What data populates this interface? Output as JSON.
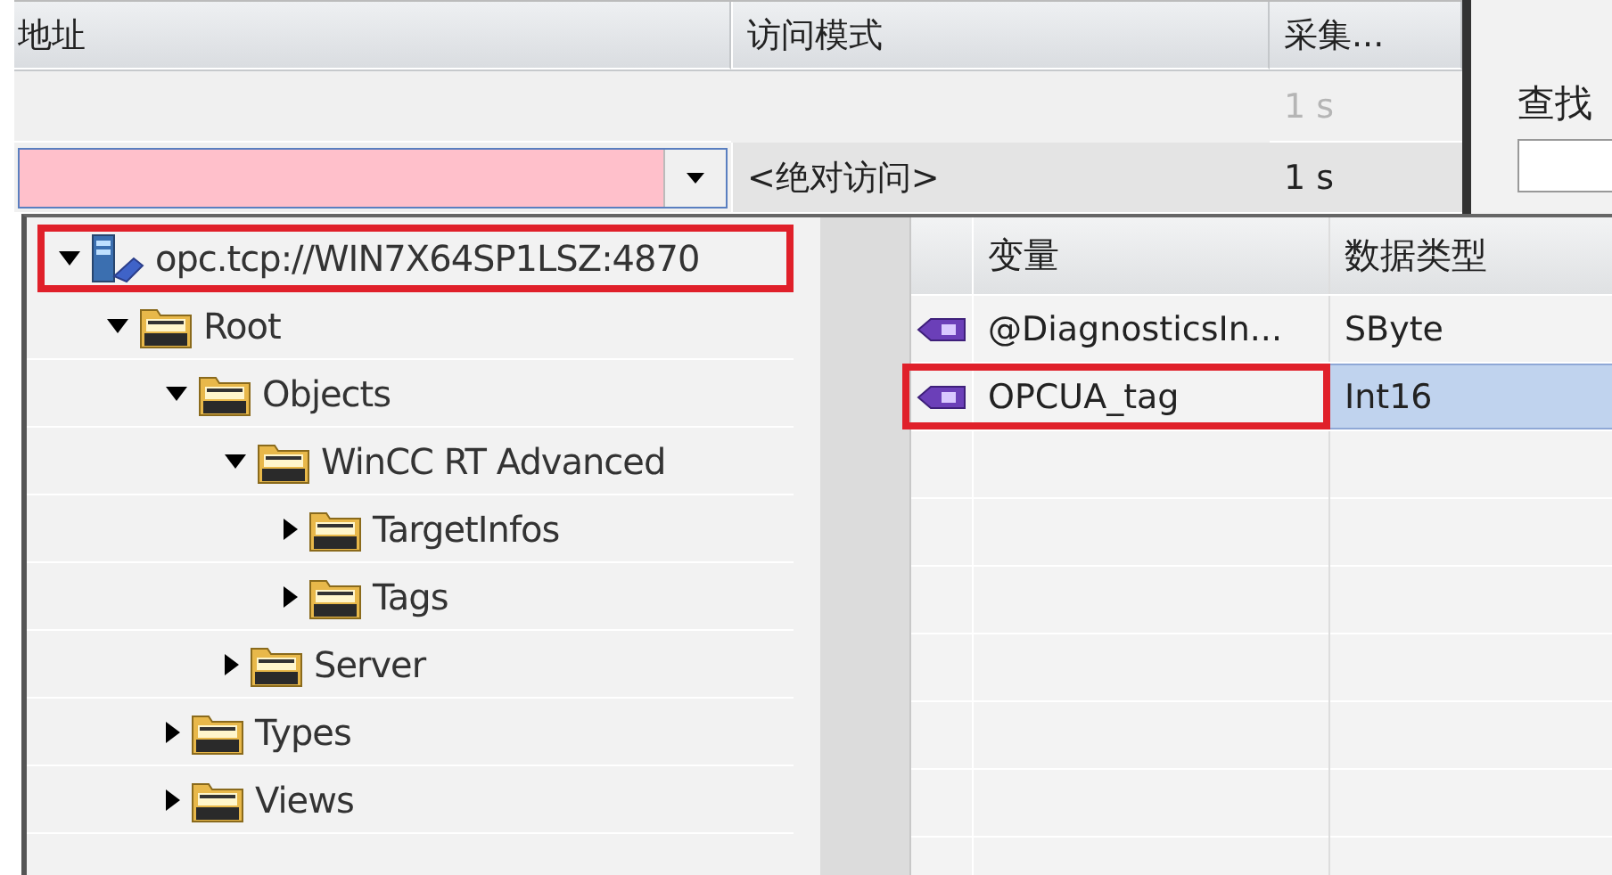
{
  "address_table": {
    "columns": [
      "地址",
      "访问模式",
      "采集..."
    ],
    "rows": [
      {
        "kind": "blank",
        "cycle": "1 s",
        "disabled": true
      },
      {
        "kind": "edit",
        "access_mode": "<绝对访问>",
        "cycle": "1 s",
        "invalid": true,
        "disabled": false
      }
    ]
  },
  "find_panel": {
    "label": "查找"
  },
  "browser": {
    "tree": [
      {
        "kind": "server",
        "label": "opc.tcp://WIN7X64SP1LSZ:4870",
        "expanded": true,
        "highlighted": true,
        "children": [
          {
            "kind": "folder",
            "label": "Root",
            "expanded": true,
            "highlighted": false,
            "children": [
              {
                "kind": "folder",
                "label": "Objects",
                "expanded": true,
                "highlighted": false,
                "children": [
                  {
                    "kind": "folder",
                    "label": "WinCC RT Advanced",
                    "expanded": true,
                    "highlighted": false,
                    "children": [
                      {
                        "kind": "folder",
                        "label": "TargetInfos",
                        "expanded": false,
                        "highlighted": false
                      },
                      {
                        "kind": "folder",
                        "label": "Tags",
                        "expanded": false,
                        "highlighted": false
                      }
                    ]
                  },
                  {
                    "kind": "folder",
                    "label": "Server",
                    "expanded": false,
                    "highlighted": false
                  }
                ]
              },
              {
                "kind": "folder",
                "label": "Types",
                "expanded": false,
                "highlighted": false
              },
              {
                "kind": "folder",
                "label": "Views",
                "expanded": false,
                "highlighted": false
              }
            ]
          }
        ]
      }
    ],
    "table": {
      "columns": [
        "变量",
        "数据类型"
      ],
      "rows": [
        {
          "name": "@DiagnosticsIn...",
          "type": "SByte",
          "selected": false,
          "highlighted": false
        },
        {
          "name": "OPCUA_tag",
          "type": "Int16",
          "selected": true,
          "highlighted": true
        }
      ]
    }
  }
}
